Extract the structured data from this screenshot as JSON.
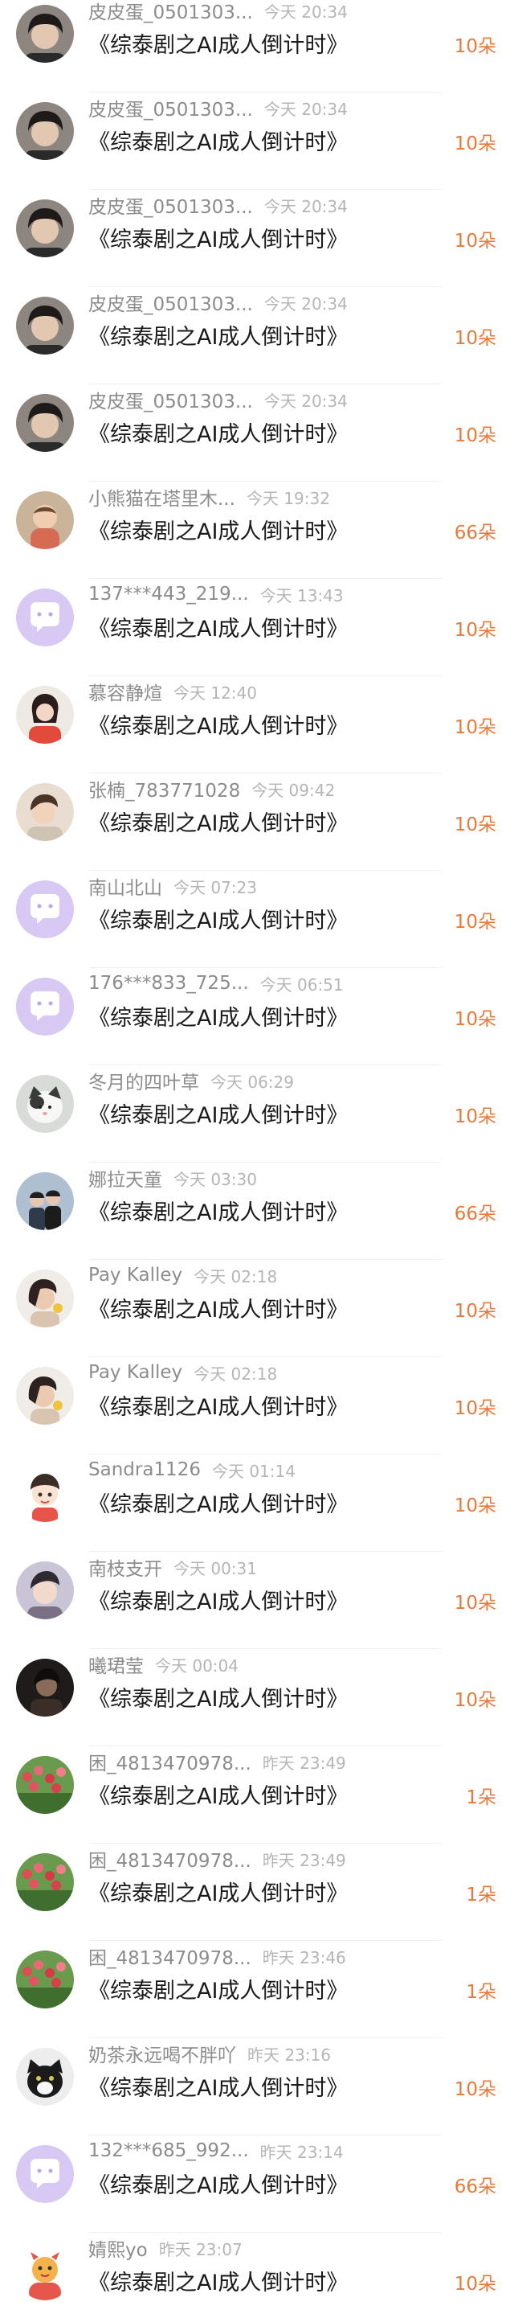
{
  "accent_color": "#e9793a",
  "gift_label": "《综泰剧之AI成人倒计时》",
  "records": [
    {
      "user": "皮皮蛋_0501303...",
      "time": "今天 20:34",
      "amount": "10朵",
      "avatar": "photo-dark-hair"
    },
    {
      "user": "皮皮蛋_0501303...",
      "time": "今天 20:34",
      "amount": "10朵",
      "avatar": "photo-dark-hair"
    },
    {
      "user": "皮皮蛋_0501303...",
      "time": "今天 20:34",
      "amount": "10朵",
      "avatar": "photo-dark-hair"
    },
    {
      "user": "皮皮蛋_0501303...",
      "time": "今天 20:34",
      "amount": "10朵",
      "avatar": "photo-dark-hair"
    },
    {
      "user": "皮皮蛋_0501303...",
      "time": "今天 20:34",
      "amount": "10朵",
      "avatar": "photo-dark-hair"
    },
    {
      "user": "小熊猫在塔里木...",
      "time": "今天 19:32",
      "amount": "66朵",
      "avatar": "photo-baby"
    },
    {
      "user": "137***443_219...",
      "time": "今天 13:43",
      "amount": "10朵",
      "avatar": "default-chat-bubble"
    },
    {
      "user": "慕容静煊",
      "time": "今天 12:40",
      "amount": "10朵",
      "avatar": "photo-girl"
    },
    {
      "user": "张楠_783771028",
      "time": "今天 09:42",
      "amount": "10朵",
      "avatar": "photo-woman-light"
    },
    {
      "user": "南山北山",
      "time": "今天 07:23",
      "amount": "10朵",
      "avatar": "default-chat-bubble"
    },
    {
      "user": "176***833_725...",
      "time": "今天 06:51",
      "amount": "10朵",
      "avatar": "default-chat-bubble"
    },
    {
      "user": "冬月的四叶草",
      "time": "今天 06:29",
      "amount": "10朵",
      "avatar": "photo-cat"
    },
    {
      "user": "娜拉天童",
      "time": "今天 03:30",
      "amount": "66朵",
      "avatar": "photo-couple"
    },
    {
      "user": "Pay Kalley",
      "time": "今天 02:18",
      "amount": "10朵",
      "avatar": "photo-woman-dark"
    },
    {
      "user": "Pay Kalley",
      "time": "今天 02:18",
      "amount": "10朵",
      "avatar": "photo-woman-dark"
    },
    {
      "user": "Sandra1126",
      "time": "今天 01:14",
      "amount": "10朵",
      "avatar": "cartoon-boy"
    },
    {
      "user": "南枝支开",
      "time": "今天 00:31",
      "amount": "10朵",
      "avatar": "photo-young-man"
    },
    {
      "user": "曦珺莹",
      "time": "今天 00:04",
      "amount": "10朵",
      "avatar": "photo-dark-portrait"
    },
    {
      "user": "困_4813470978...",
      "time": "昨天 23:49",
      "amount": "1朵",
      "avatar": "photo-tulips"
    },
    {
      "user": "困_4813470978...",
      "time": "昨天 23:49",
      "amount": "1朵",
      "avatar": "photo-tulips"
    },
    {
      "user": "困_4813470978...",
      "time": "昨天 23:46",
      "amount": "1朵",
      "avatar": "photo-tulips"
    },
    {
      "user": "奶茶永远喝不胖吖",
      "time": "昨天 23:16",
      "amount": "10朵",
      "avatar": "photo-black-cat"
    },
    {
      "user": "132***685_992...",
      "time": "昨天 23:14",
      "amount": "66朵",
      "avatar": "default-chat-bubble"
    },
    {
      "user": "婧熙yo",
      "time": "昨天 23:07",
      "amount": "10朵",
      "avatar": "cartoon-dragon"
    }
  ]
}
